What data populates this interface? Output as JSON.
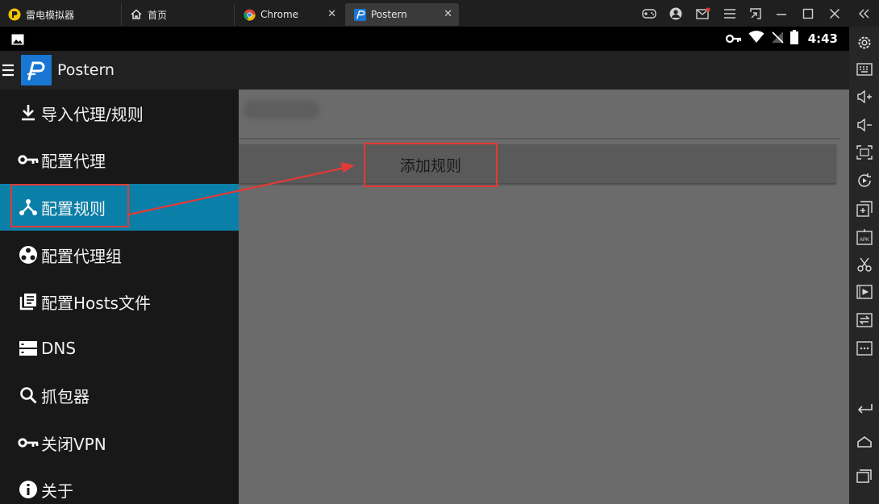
{
  "window": {
    "tabs": [
      {
        "label": "雷电模拟器"
      },
      {
        "label": "首页"
      },
      {
        "label": "Chrome"
      },
      {
        "label": "Postern"
      }
    ],
    "close_glyph": "✕"
  },
  "statusbar": {
    "time": "4:43"
  },
  "app": {
    "title": "Postern"
  },
  "drawer": {
    "items": [
      {
        "label": "导入代理/规则",
        "icon": "download-icon"
      },
      {
        "label": "配置代理",
        "icon": "key-icon"
      },
      {
        "label": "配置规则",
        "icon": "rules-icon"
      },
      {
        "label": "配置代理组",
        "icon": "group-icon"
      },
      {
        "label": "配置Hosts文件",
        "icon": "hosts-file-icon"
      },
      {
        "label": "DNS",
        "icon": "dns-icon"
      },
      {
        "label": "抓包器",
        "icon": "search-icon"
      },
      {
        "label": "关闭VPN",
        "icon": "key-icon"
      },
      {
        "label": "关于",
        "icon": "info-icon"
      }
    ],
    "active_index": 2
  },
  "content": {
    "add_rule_label": "添加规则"
  },
  "colors": {
    "accent_active": "#0a7fa8",
    "highlight_red": "#e53935",
    "logo_blue": "#1976d2"
  }
}
